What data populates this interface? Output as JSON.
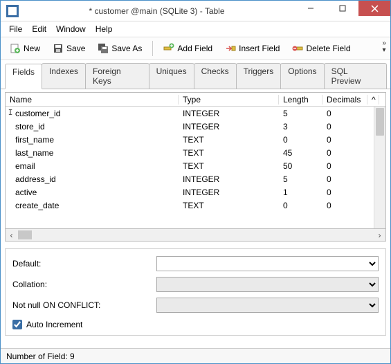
{
  "window": {
    "title": "* customer @main (SQLite 3) - Table"
  },
  "menu": {
    "file": "File",
    "edit": "Edit",
    "window": "Window",
    "help": "Help"
  },
  "toolbar": {
    "new": "New",
    "save": "Save",
    "saveAs": "Save As",
    "addField": "Add Field",
    "insertField": "Insert Field",
    "deleteField": "Delete Field"
  },
  "tabs": {
    "fields": "Fields",
    "indexes": "Indexes",
    "foreignKeys": "Foreign Keys",
    "uniques": "Uniques",
    "checks": "Checks",
    "triggers": "Triggers",
    "options": "Options",
    "sqlPreview": "SQL Preview"
  },
  "columns": {
    "name": "Name",
    "type": "Type",
    "length": "Length",
    "decimals": "Decimals"
  },
  "rows": [
    {
      "name": "customer_id",
      "type": "INTEGER",
      "length": "5",
      "decimals": "0"
    },
    {
      "name": "store_id",
      "type": "INTEGER",
      "length": "3",
      "decimals": "0"
    },
    {
      "name": "first_name",
      "type": "TEXT",
      "length": "0",
      "decimals": "0"
    },
    {
      "name": "last_name",
      "type": "TEXT",
      "length": "45",
      "decimals": "0"
    },
    {
      "name": "email",
      "type": "TEXT",
      "length": "50",
      "decimals": "0"
    },
    {
      "name": "address_id",
      "type": "INTEGER",
      "length": "5",
      "decimals": "0"
    },
    {
      "name": "active",
      "type": "INTEGER",
      "length": "1",
      "decimals": "0"
    },
    {
      "name": "create_date",
      "type": "TEXT",
      "length": "0",
      "decimals": "0"
    }
  ],
  "form": {
    "defaultLabel": "Default:",
    "collationLabel": "Collation:",
    "notNullLabel": "Not null ON CONFLICT:",
    "autoIncrementLabel": "Auto Increment",
    "defaultValue": "",
    "collationValue": "",
    "notNullValue": "",
    "autoIncrementChecked": true
  },
  "status": {
    "text": "Number of Field: 9"
  }
}
